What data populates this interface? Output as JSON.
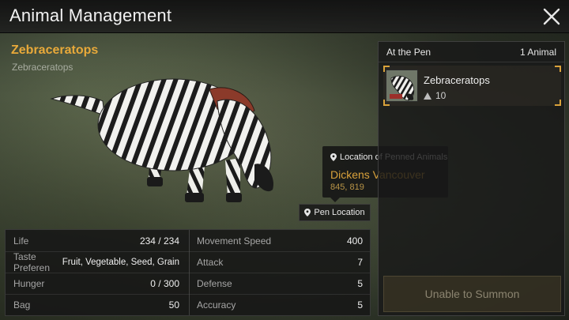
{
  "window": {
    "title": "Animal Management"
  },
  "animal": {
    "name": "Zebraceratops",
    "species": "Zebraceratops"
  },
  "tooltip": {
    "heading": "Location of Penned Animals",
    "location": "Dickens Vancouver",
    "coordinates": "845, 819"
  },
  "pen_location_button": "Pen Location",
  "stats": {
    "left": [
      {
        "label": "Life",
        "value": "234 / 234"
      },
      {
        "label": "Taste Preferen",
        "value": "Fruit, Vegetable, Seed, Grain"
      },
      {
        "label": "Hunger",
        "value": "0 / 300"
      },
      {
        "label": "Bag",
        "value": "50"
      }
    ],
    "right": [
      {
        "label": "Movement Speed",
        "value": "400"
      },
      {
        "label": "Attack",
        "value": "7"
      },
      {
        "label": "Defense",
        "value": "5"
      },
      {
        "label": "Accuracy",
        "value": "5"
      }
    ]
  },
  "pen": {
    "title": "At the Pen",
    "count": "1 Animal",
    "items": [
      {
        "name": "Zebraceratops",
        "level": "10"
      }
    ],
    "summon_label": "Unable to Summon"
  },
  "colors": {
    "accent": "#e8a93a",
    "location": "#d9a23b"
  },
  "icons": {
    "close": "close-icon",
    "location": "location-pin-icon",
    "level": "level-triangle-icon"
  }
}
